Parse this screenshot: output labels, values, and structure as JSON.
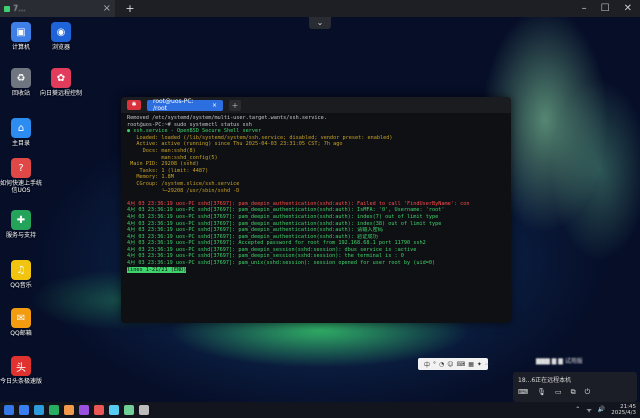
{
  "topbar": {
    "tab_title": "7...",
    "tab_close": "×",
    "new_tab": "+",
    "minimize": "–",
    "maximize": "☐",
    "close": "✕",
    "collapse": "⌄"
  },
  "desktop": {
    "icons": [
      {
        "label": "计算机",
        "color": "#3d7fe6",
        "glyph": "▣"
      },
      {
        "label": "浏览器",
        "color": "#1e63d8",
        "glyph": "◉"
      },
      {
        "label": "回收站",
        "color": "#707680",
        "glyph": "♻"
      },
      {
        "label": "向日葵远程控制",
        "color": "#e23c5c",
        "glyph": "✿"
      },
      {
        "label": "主目录",
        "color": "#2d8cf0",
        "glyph": "⌂"
      },
      {
        "label": "如何快速上手统信UOS",
        "color": "#e04848",
        "glyph": "?"
      },
      {
        "label": "服务与支持",
        "color": "#24a35a",
        "glyph": "✚"
      },
      {
        "label": "QQ音乐",
        "color": "#f1c40f",
        "glyph": "♫"
      },
      {
        "label": "QQ邮箱",
        "color": "#f39c12",
        "glyph": "✉"
      },
      {
        "label": "今日头条极速版",
        "color": "#e0322f",
        "glyph": "头"
      }
    ]
  },
  "terminal": {
    "logo": "✱",
    "tab_title": "root@uos-PC: /root",
    "tab_close": "×",
    "add": "+",
    "lines": [
      {
        "cls": "w",
        "text": "Removed /etc/systemd/system/multi-user.target.wants/ssh.service."
      },
      {
        "cls": "w",
        "text": "root@uos-PC:~# sudo systemctl status ssh"
      },
      {
        "cls": "g",
        "text": "● ssh.service - OpenBSD Secure Shell server"
      },
      {
        "cls": "y",
        "text": "   Loaded: loaded (/lib/systemd/system/ssh.service; disabled; vendor preset: enabled)"
      },
      {
        "cls": "y",
        "text": "   Active: active (running) since Thu 2025-04-03 23:31:05 CST; 7h ago"
      },
      {
        "cls": "y",
        "text": "     Docs: man:sshd(8)"
      },
      {
        "cls": "y",
        "text": "           man:sshd_config(5)"
      },
      {
        "cls": "y",
        "text": " Main PID: 29208 (sshd)"
      },
      {
        "cls": "y",
        "text": "    Tasks: 1 (limit: 4487)"
      },
      {
        "cls": "y",
        "text": "   Memory: 1.8M"
      },
      {
        "cls": "y",
        "text": "   CGroup: /system.slice/ssh.service"
      },
      {
        "cls": "y",
        "text": "           └─29208 /usr/sbin/sshd -D"
      },
      {
        "cls": "w",
        "text": " "
      },
      {
        "cls": "r",
        "text": "4月 03 23:36:19 uos-PC sshd[37697]: pam_deepin_authentication(sshd:auth): Failed to call 'FindUserByName': con"
      },
      {
        "cls": "g",
        "text": "4月 03 23:36:19 uos-PC sshd[37697]: pam_deepin_authentication(sshd:auth): IsMFA: '0', Username: 'root'"
      },
      {
        "cls": "g",
        "text": "4月 03 23:36:19 uos-PC sshd[37697]: pam_deepin_authentication(sshd:auth): index(7) out of limit type"
      },
      {
        "cls": "g",
        "text": "4月 03 23:36:19 uos-PC sshd[37697]: pam_deepin_authentication(sshd:auth): index(38) out of limit type"
      },
      {
        "cls": "g",
        "text": "4月 03 23:36:19 uos-PC sshd[37697]: pam_deepin_authentication(sshd:auth): 请输入密码"
      },
      {
        "cls": "g",
        "text": "4月 03 23:36:19 uos-PC sshd[37697]: pam_deepin_authentication(sshd:auth): 验证成功"
      },
      {
        "cls": "g",
        "text": "4月 03 23:36:19 uos-PC sshd[37697]: Accepted password for root from 192.168.68.1 port 11790 ssh2"
      },
      {
        "cls": "g",
        "text": "4月 03 23:36:19 uos-PC sshd[37697]: pam_deepin_session(sshd:session): dbus service is :active"
      },
      {
        "cls": "g",
        "text": "4月 03 23:36:19 uos-PC sshd[37697]: pam_deepin_session(sshd:session): the terminal is : 0"
      },
      {
        "cls": "g",
        "text": "4月 03 23:36:19 uos-PC sshd[37697]: pam_unix(sshd:session): session opened for user root by (uid=0)"
      }
    ],
    "status": "lines 1-21/21 (END)"
  },
  "ime": {
    "items": [
      "中",
      "°",
      "◔",
      "☺",
      "⌨",
      "▦",
      "✦",
      "⋯"
    ]
  },
  "notification": {
    "text": "18...6正在远程本机",
    "actions": [
      "⌨",
      "🎙",
      "▭",
      "⧉",
      "⏻"
    ]
  },
  "taskbar": {
    "apps": [
      "#3a7ff0",
      "#2d9cdb",
      "#27ae60",
      "#f2994a",
      "#9b51e0",
      "#eb5757",
      "#56ccf2",
      "#6fcf97",
      "#bdbdbd"
    ],
    "tray": [
      "⌃",
      "ᯤ",
      "🔊"
    ],
    "time": "21:45",
    "date": "2025/4/3"
  }
}
